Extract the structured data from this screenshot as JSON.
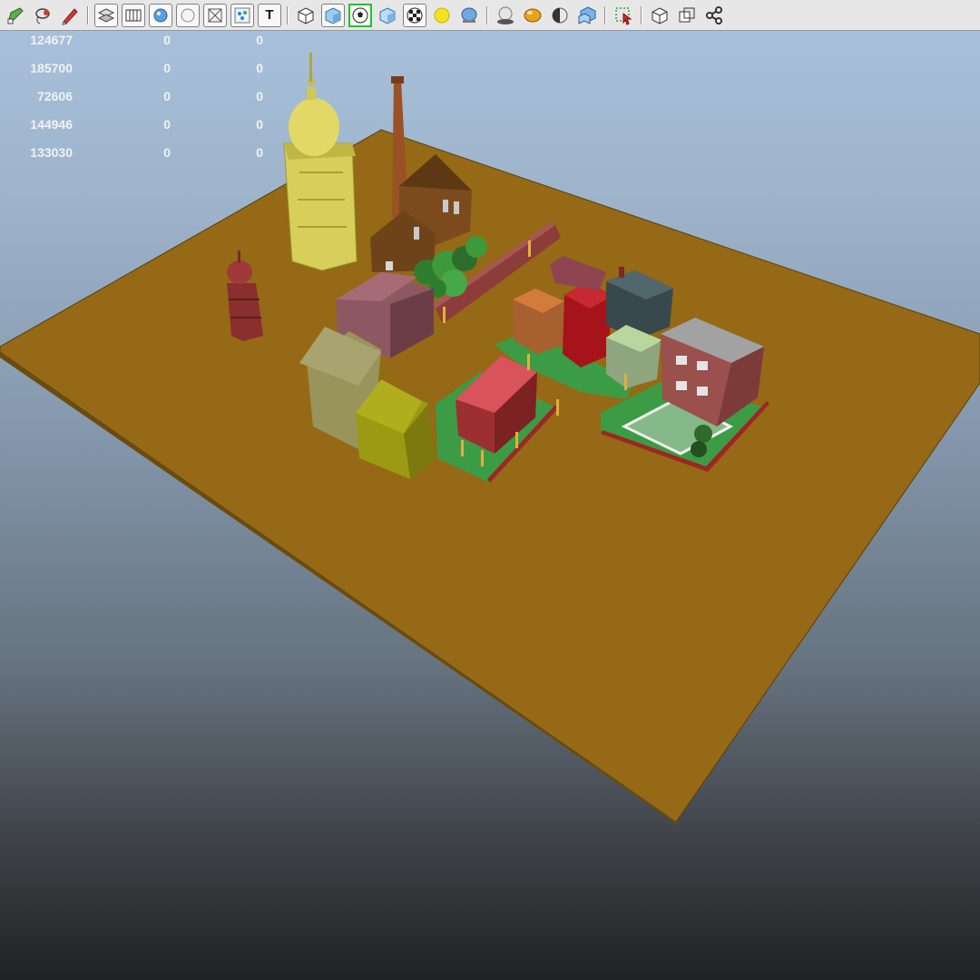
{
  "toolbar": {
    "items": [
      {
        "name": "tool-select-icon",
        "type": "icon"
      },
      {
        "name": "tool-lasso-icon",
        "type": "icon"
      },
      {
        "name": "tool-paint-icon",
        "type": "icon"
      },
      {
        "name": "sep"
      },
      {
        "name": "display-layer-icon",
        "type": "boxed"
      },
      {
        "name": "film-gate-icon",
        "type": "boxed"
      },
      {
        "name": "sphere-shaded-icon",
        "type": "boxed"
      },
      {
        "name": "sphere-wire-icon",
        "type": "boxed"
      },
      {
        "name": "x-ray-icon",
        "type": "boxed"
      },
      {
        "name": "particles-icon",
        "type": "boxed"
      },
      {
        "name": "text-label-icon",
        "type": "boxed",
        "text": "T"
      },
      {
        "name": "sep"
      },
      {
        "name": "wireframe-cube-icon",
        "type": "icon"
      },
      {
        "name": "smooth-shade-cube-icon",
        "type": "boxed"
      },
      {
        "name": "soccer-ball-icon",
        "type": "active"
      },
      {
        "name": "flat-cube-icon",
        "type": "icon"
      },
      {
        "name": "checker-texture-icon",
        "type": "boxed"
      },
      {
        "name": "sun-light-icon",
        "type": "icon"
      },
      {
        "name": "default-light-icon",
        "type": "icon"
      },
      {
        "name": "sep"
      },
      {
        "name": "shadow-sphere-icon",
        "type": "icon"
      },
      {
        "name": "gold-sphere-icon",
        "type": "icon"
      },
      {
        "name": "half-sphere-icon",
        "type": "icon"
      },
      {
        "name": "blue-cube-icon",
        "type": "icon"
      },
      {
        "name": "sep"
      },
      {
        "name": "isolate-select-icon",
        "type": "icon"
      },
      {
        "name": "sep"
      },
      {
        "name": "backface-cube-icon",
        "type": "icon"
      },
      {
        "name": "overlap-squares-icon",
        "type": "icon"
      },
      {
        "name": "share-nodes-icon",
        "type": "icon"
      }
    ]
  },
  "hud": {
    "rows": [
      [
        "124677",
        "0",
        "0"
      ],
      [
        "185700",
        "0",
        "0"
      ],
      [
        "72606",
        "0",
        "0"
      ],
      [
        "144946",
        "0",
        "0"
      ],
      [
        "133030",
        "0",
        "0"
      ]
    ]
  },
  "colors": {
    "ground": "#956915",
    "grass": "#3c9c45",
    "dome": "#d8cf5b",
    "toolbar_bg": "#e7e7e7",
    "active_outline": "#21c22b"
  }
}
